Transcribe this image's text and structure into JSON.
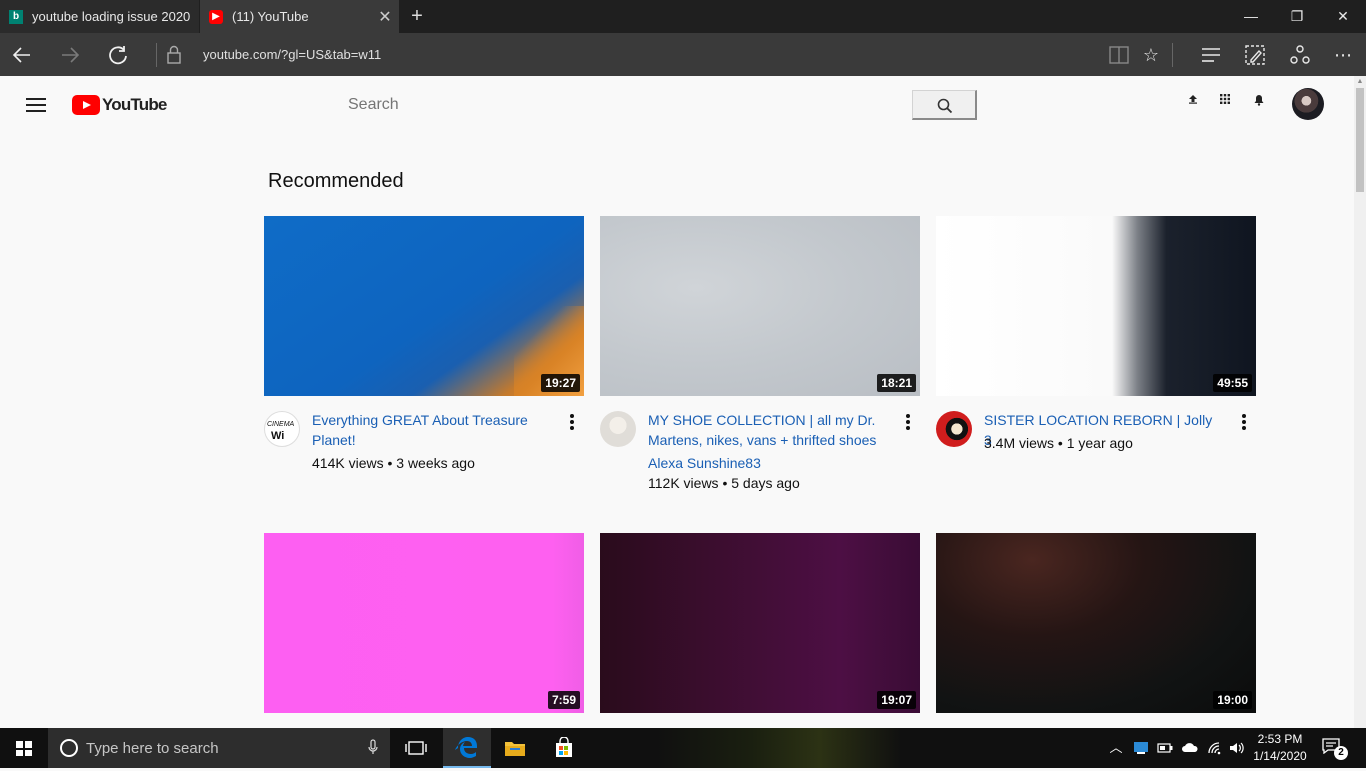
{
  "browser": {
    "tabs": [
      {
        "label": "youtube loading issue 2020",
        "favicon": "bing-icon",
        "active": false
      },
      {
        "label": "(11) YouTube",
        "favicon": "youtube-icon",
        "active": true
      }
    ],
    "url": "youtube.com/?gl=US&tab=w11",
    "new_tab_glyph": "+",
    "close_glyph": "✕",
    "window_controls": {
      "minimize": "—",
      "maximize": "❐",
      "close": "✕"
    }
  },
  "youtube": {
    "logo_text": "YouTube",
    "search_placeholder": "Search",
    "section_title": "Recommended",
    "videos": [
      {
        "title": "Everything GREAT About Treasure Planet!",
        "channel": "",
        "stats": "414K views • 3 weeks ago",
        "duration": "19:27"
      },
      {
        "title": "MY SHOE COLLECTION | all my Dr. Martens, nikes, vans + thrifted shoes",
        "channel": "Alexa Sunshine83",
        "stats": "112K views • 5 days ago",
        "duration": "18:21"
      },
      {
        "title": "SISTER LOCATION REBORN | Jolly 3",
        "channel": "",
        "stats": "3.4M views • 1 year ago",
        "duration": "49:55"
      },
      {
        "title": "",
        "channel": "",
        "stats": "",
        "duration": "7:59"
      },
      {
        "title": "",
        "channel": "",
        "stats": "",
        "duration": "19:07"
      },
      {
        "title": "",
        "channel": "",
        "stats": "",
        "duration": "19:00"
      }
    ],
    "channel_logo_text": {
      "line1": "CINEMA",
      "line2": "Wi"
    }
  },
  "taskbar": {
    "search_placeholder": "Type here to search",
    "time": "2:53 PM",
    "date": "1/14/2020",
    "notification_count": "2"
  },
  "colors": {
    "youtube_red": "#ff0000",
    "link_blue": "#1a5fb4",
    "edge_blue": "#0078d7"
  }
}
